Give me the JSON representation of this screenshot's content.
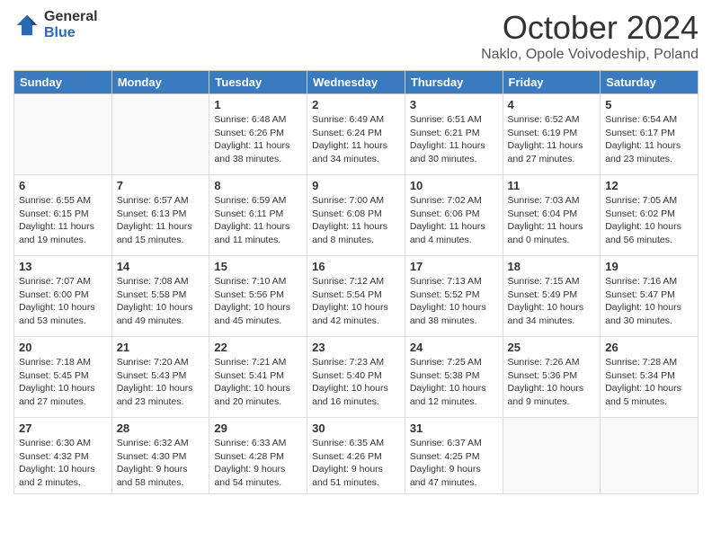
{
  "logo": {
    "general": "General",
    "blue": "Blue"
  },
  "header": {
    "month": "October 2024",
    "location": "Naklo, Opole Voivodeship, Poland"
  },
  "weekdays": [
    "Sunday",
    "Monday",
    "Tuesday",
    "Wednesday",
    "Thursday",
    "Friday",
    "Saturday"
  ],
  "weeks": [
    [
      {
        "day": "",
        "sunrise": "",
        "sunset": "",
        "daylight": ""
      },
      {
        "day": "",
        "sunrise": "",
        "sunset": "",
        "daylight": ""
      },
      {
        "day": "1",
        "sunrise": "Sunrise: 6:48 AM",
        "sunset": "Sunset: 6:26 PM",
        "daylight": "Daylight: 11 hours and 38 minutes."
      },
      {
        "day": "2",
        "sunrise": "Sunrise: 6:49 AM",
        "sunset": "Sunset: 6:24 PM",
        "daylight": "Daylight: 11 hours and 34 minutes."
      },
      {
        "day": "3",
        "sunrise": "Sunrise: 6:51 AM",
        "sunset": "Sunset: 6:21 PM",
        "daylight": "Daylight: 11 hours and 30 minutes."
      },
      {
        "day": "4",
        "sunrise": "Sunrise: 6:52 AM",
        "sunset": "Sunset: 6:19 PM",
        "daylight": "Daylight: 11 hours and 27 minutes."
      },
      {
        "day": "5",
        "sunrise": "Sunrise: 6:54 AM",
        "sunset": "Sunset: 6:17 PM",
        "daylight": "Daylight: 11 hours and 23 minutes."
      }
    ],
    [
      {
        "day": "6",
        "sunrise": "Sunrise: 6:55 AM",
        "sunset": "Sunset: 6:15 PM",
        "daylight": "Daylight: 11 hours and 19 minutes."
      },
      {
        "day": "7",
        "sunrise": "Sunrise: 6:57 AM",
        "sunset": "Sunset: 6:13 PM",
        "daylight": "Daylight: 11 hours and 15 minutes."
      },
      {
        "day": "8",
        "sunrise": "Sunrise: 6:59 AM",
        "sunset": "Sunset: 6:11 PM",
        "daylight": "Daylight: 11 hours and 11 minutes."
      },
      {
        "day": "9",
        "sunrise": "Sunrise: 7:00 AM",
        "sunset": "Sunset: 6:08 PM",
        "daylight": "Daylight: 11 hours and 8 minutes."
      },
      {
        "day": "10",
        "sunrise": "Sunrise: 7:02 AM",
        "sunset": "Sunset: 6:06 PM",
        "daylight": "Daylight: 11 hours and 4 minutes."
      },
      {
        "day": "11",
        "sunrise": "Sunrise: 7:03 AM",
        "sunset": "Sunset: 6:04 PM",
        "daylight": "Daylight: 11 hours and 0 minutes."
      },
      {
        "day": "12",
        "sunrise": "Sunrise: 7:05 AM",
        "sunset": "Sunset: 6:02 PM",
        "daylight": "Daylight: 10 hours and 56 minutes."
      }
    ],
    [
      {
        "day": "13",
        "sunrise": "Sunrise: 7:07 AM",
        "sunset": "Sunset: 6:00 PM",
        "daylight": "Daylight: 10 hours and 53 minutes."
      },
      {
        "day": "14",
        "sunrise": "Sunrise: 7:08 AM",
        "sunset": "Sunset: 5:58 PM",
        "daylight": "Daylight: 10 hours and 49 minutes."
      },
      {
        "day": "15",
        "sunrise": "Sunrise: 7:10 AM",
        "sunset": "Sunset: 5:56 PM",
        "daylight": "Daylight: 10 hours and 45 minutes."
      },
      {
        "day": "16",
        "sunrise": "Sunrise: 7:12 AM",
        "sunset": "Sunset: 5:54 PM",
        "daylight": "Daylight: 10 hours and 42 minutes."
      },
      {
        "day": "17",
        "sunrise": "Sunrise: 7:13 AM",
        "sunset": "Sunset: 5:52 PM",
        "daylight": "Daylight: 10 hours and 38 minutes."
      },
      {
        "day": "18",
        "sunrise": "Sunrise: 7:15 AM",
        "sunset": "Sunset: 5:49 PM",
        "daylight": "Daylight: 10 hours and 34 minutes."
      },
      {
        "day": "19",
        "sunrise": "Sunrise: 7:16 AM",
        "sunset": "Sunset: 5:47 PM",
        "daylight": "Daylight: 10 hours and 30 minutes."
      }
    ],
    [
      {
        "day": "20",
        "sunrise": "Sunrise: 7:18 AM",
        "sunset": "Sunset: 5:45 PM",
        "daylight": "Daylight: 10 hours and 27 minutes."
      },
      {
        "day": "21",
        "sunrise": "Sunrise: 7:20 AM",
        "sunset": "Sunset: 5:43 PM",
        "daylight": "Daylight: 10 hours and 23 minutes."
      },
      {
        "day": "22",
        "sunrise": "Sunrise: 7:21 AM",
        "sunset": "Sunset: 5:41 PM",
        "daylight": "Daylight: 10 hours and 20 minutes."
      },
      {
        "day": "23",
        "sunrise": "Sunrise: 7:23 AM",
        "sunset": "Sunset: 5:40 PM",
        "daylight": "Daylight: 10 hours and 16 minutes."
      },
      {
        "day": "24",
        "sunrise": "Sunrise: 7:25 AM",
        "sunset": "Sunset: 5:38 PM",
        "daylight": "Daylight: 10 hours and 12 minutes."
      },
      {
        "day": "25",
        "sunrise": "Sunrise: 7:26 AM",
        "sunset": "Sunset: 5:36 PM",
        "daylight": "Daylight: 10 hours and 9 minutes."
      },
      {
        "day": "26",
        "sunrise": "Sunrise: 7:28 AM",
        "sunset": "Sunset: 5:34 PM",
        "daylight": "Daylight: 10 hours and 5 minutes."
      }
    ],
    [
      {
        "day": "27",
        "sunrise": "Sunrise: 6:30 AM",
        "sunset": "Sunset: 4:32 PM",
        "daylight": "Daylight: 10 hours and 2 minutes."
      },
      {
        "day": "28",
        "sunrise": "Sunrise: 6:32 AM",
        "sunset": "Sunset: 4:30 PM",
        "daylight": "Daylight: 9 hours and 58 minutes."
      },
      {
        "day": "29",
        "sunrise": "Sunrise: 6:33 AM",
        "sunset": "Sunset: 4:28 PM",
        "daylight": "Daylight: 9 hours and 54 minutes."
      },
      {
        "day": "30",
        "sunrise": "Sunrise: 6:35 AM",
        "sunset": "Sunset: 4:26 PM",
        "daylight": "Daylight: 9 hours and 51 minutes."
      },
      {
        "day": "31",
        "sunrise": "Sunrise: 6:37 AM",
        "sunset": "Sunset: 4:25 PM",
        "daylight": "Daylight: 9 hours and 47 minutes."
      },
      {
        "day": "",
        "sunrise": "",
        "sunset": "",
        "daylight": ""
      },
      {
        "day": "",
        "sunrise": "",
        "sunset": "",
        "daylight": ""
      }
    ]
  ]
}
